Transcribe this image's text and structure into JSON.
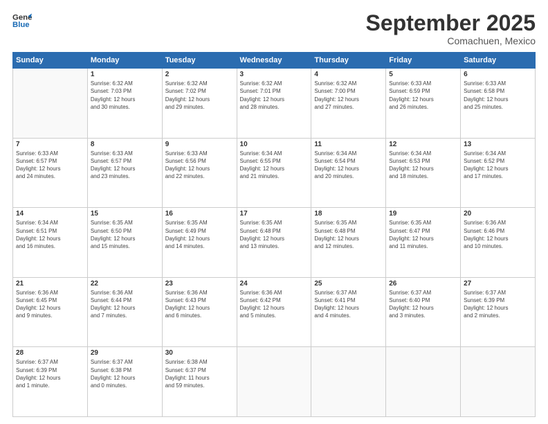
{
  "header": {
    "logo_line1": "General",
    "logo_line2": "Blue",
    "month": "September 2025",
    "location": "Comachuen, Mexico"
  },
  "weekdays": [
    "Sunday",
    "Monday",
    "Tuesday",
    "Wednesday",
    "Thursday",
    "Friday",
    "Saturday"
  ],
  "weeks": [
    [
      {
        "day": "",
        "info": ""
      },
      {
        "day": "1",
        "info": "Sunrise: 6:32 AM\nSunset: 7:03 PM\nDaylight: 12 hours\nand 30 minutes."
      },
      {
        "day": "2",
        "info": "Sunrise: 6:32 AM\nSunset: 7:02 PM\nDaylight: 12 hours\nand 29 minutes."
      },
      {
        "day": "3",
        "info": "Sunrise: 6:32 AM\nSunset: 7:01 PM\nDaylight: 12 hours\nand 28 minutes."
      },
      {
        "day": "4",
        "info": "Sunrise: 6:32 AM\nSunset: 7:00 PM\nDaylight: 12 hours\nand 27 minutes."
      },
      {
        "day": "5",
        "info": "Sunrise: 6:33 AM\nSunset: 6:59 PM\nDaylight: 12 hours\nand 26 minutes."
      },
      {
        "day": "6",
        "info": "Sunrise: 6:33 AM\nSunset: 6:58 PM\nDaylight: 12 hours\nand 25 minutes."
      }
    ],
    [
      {
        "day": "7",
        "info": "Sunrise: 6:33 AM\nSunset: 6:57 PM\nDaylight: 12 hours\nand 24 minutes."
      },
      {
        "day": "8",
        "info": "Sunrise: 6:33 AM\nSunset: 6:57 PM\nDaylight: 12 hours\nand 23 minutes."
      },
      {
        "day": "9",
        "info": "Sunrise: 6:33 AM\nSunset: 6:56 PM\nDaylight: 12 hours\nand 22 minutes."
      },
      {
        "day": "10",
        "info": "Sunrise: 6:34 AM\nSunset: 6:55 PM\nDaylight: 12 hours\nand 21 minutes."
      },
      {
        "day": "11",
        "info": "Sunrise: 6:34 AM\nSunset: 6:54 PM\nDaylight: 12 hours\nand 20 minutes."
      },
      {
        "day": "12",
        "info": "Sunrise: 6:34 AM\nSunset: 6:53 PM\nDaylight: 12 hours\nand 18 minutes."
      },
      {
        "day": "13",
        "info": "Sunrise: 6:34 AM\nSunset: 6:52 PM\nDaylight: 12 hours\nand 17 minutes."
      }
    ],
    [
      {
        "day": "14",
        "info": "Sunrise: 6:34 AM\nSunset: 6:51 PM\nDaylight: 12 hours\nand 16 minutes."
      },
      {
        "day": "15",
        "info": "Sunrise: 6:35 AM\nSunset: 6:50 PM\nDaylight: 12 hours\nand 15 minutes."
      },
      {
        "day": "16",
        "info": "Sunrise: 6:35 AM\nSunset: 6:49 PM\nDaylight: 12 hours\nand 14 minutes."
      },
      {
        "day": "17",
        "info": "Sunrise: 6:35 AM\nSunset: 6:48 PM\nDaylight: 12 hours\nand 13 minutes."
      },
      {
        "day": "18",
        "info": "Sunrise: 6:35 AM\nSunset: 6:48 PM\nDaylight: 12 hours\nand 12 minutes."
      },
      {
        "day": "19",
        "info": "Sunrise: 6:35 AM\nSunset: 6:47 PM\nDaylight: 12 hours\nand 11 minutes."
      },
      {
        "day": "20",
        "info": "Sunrise: 6:36 AM\nSunset: 6:46 PM\nDaylight: 12 hours\nand 10 minutes."
      }
    ],
    [
      {
        "day": "21",
        "info": "Sunrise: 6:36 AM\nSunset: 6:45 PM\nDaylight: 12 hours\nand 9 minutes."
      },
      {
        "day": "22",
        "info": "Sunrise: 6:36 AM\nSunset: 6:44 PM\nDaylight: 12 hours\nand 7 minutes."
      },
      {
        "day": "23",
        "info": "Sunrise: 6:36 AM\nSunset: 6:43 PM\nDaylight: 12 hours\nand 6 minutes."
      },
      {
        "day": "24",
        "info": "Sunrise: 6:36 AM\nSunset: 6:42 PM\nDaylight: 12 hours\nand 5 minutes."
      },
      {
        "day": "25",
        "info": "Sunrise: 6:37 AM\nSunset: 6:41 PM\nDaylight: 12 hours\nand 4 minutes."
      },
      {
        "day": "26",
        "info": "Sunrise: 6:37 AM\nSunset: 6:40 PM\nDaylight: 12 hours\nand 3 minutes."
      },
      {
        "day": "27",
        "info": "Sunrise: 6:37 AM\nSunset: 6:39 PM\nDaylight: 12 hours\nand 2 minutes."
      }
    ],
    [
      {
        "day": "28",
        "info": "Sunrise: 6:37 AM\nSunset: 6:39 PM\nDaylight: 12 hours\nand 1 minute."
      },
      {
        "day": "29",
        "info": "Sunrise: 6:37 AM\nSunset: 6:38 PM\nDaylight: 12 hours\nand 0 minutes."
      },
      {
        "day": "30",
        "info": "Sunrise: 6:38 AM\nSunset: 6:37 PM\nDaylight: 11 hours\nand 59 minutes."
      },
      {
        "day": "",
        "info": ""
      },
      {
        "day": "",
        "info": ""
      },
      {
        "day": "",
        "info": ""
      },
      {
        "day": "",
        "info": ""
      }
    ]
  ]
}
